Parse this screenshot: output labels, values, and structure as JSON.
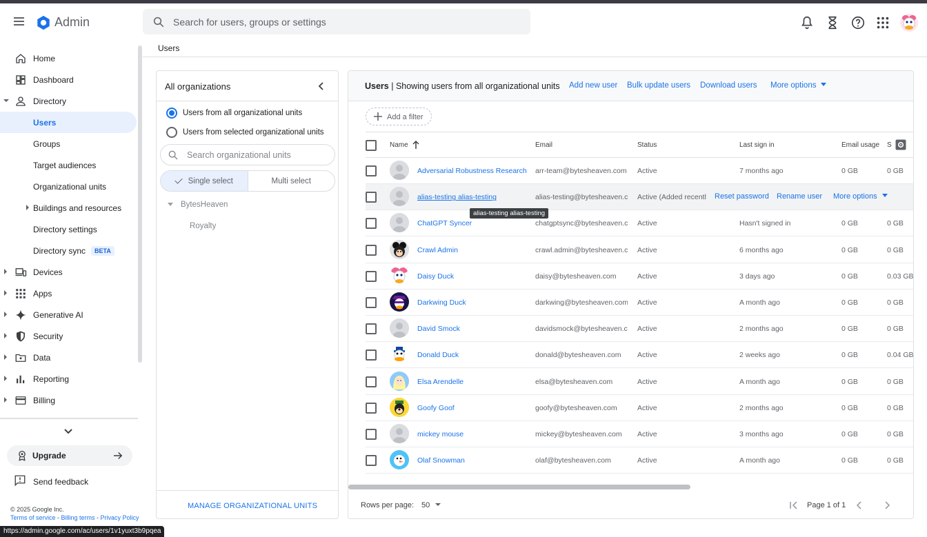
{
  "header": {
    "app_title": "Admin",
    "search_placeholder": "Search for users, groups or settings",
    "icons": [
      "notifications-icon",
      "tasks-icon",
      "help-icon",
      "apps-grid-icon",
      "account-avatar"
    ]
  },
  "breadcrumb": "Users",
  "sidebar": {
    "items": [
      {
        "label": "Home",
        "icon": "home-icon"
      },
      {
        "label": "Dashboard",
        "icon": "dashboard-icon"
      },
      {
        "label": "Directory",
        "icon": "person-icon",
        "expanded": true
      },
      {
        "label": "Users",
        "active": true
      },
      {
        "label": "Groups"
      },
      {
        "label": "Target audiences"
      },
      {
        "label": "Organizational units"
      },
      {
        "label": "Buildings and resources"
      },
      {
        "label": "Directory settings"
      },
      {
        "label": "Directory sync",
        "badge": "BETA"
      },
      {
        "label": "Devices",
        "icon": "devices-icon"
      },
      {
        "label": "Apps",
        "icon": "apps-icon"
      },
      {
        "label": "Generative AI",
        "icon": "sparkle-icon"
      },
      {
        "label": "Security",
        "icon": "shield-icon"
      },
      {
        "label": "Data",
        "icon": "folder-icon"
      },
      {
        "label": "Reporting",
        "icon": "bar-chart-icon"
      },
      {
        "label": "Billing",
        "icon": "credit-card-icon"
      }
    ],
    "upgrade": "Upgrade",
    "send_feedback": "Send feedback",
    "copyright": "© 2025 Google Inc.",
    "terms": "Terms of service",
    "billing_terms": "Billing terms",
    "privacy": "Privacy Policy",
    "legal_sep": " - "
  },
  "status_url": "https://admin.google.com/ac/users/1v1yuxt3b9pqea",
  "org_panel": {
    "title": "All organizations",
    "radio_all": "Users from all organizational units",
    "radio_selected": "Users from selected organizational units",
    "search_placeholder": "Search organizational units",
    "single_select": "Single select",
    "multi_select": "Multi select",
    "tree": [
      "BytesHeaven",
      "Royalty"
    ],
    "manage": "MANAGE ORGANIZATIONAL UNITS"
  },
  "users_panel": {
    "title_bold": "Users",
    "title_rest": " | Showing users from all organizational units",
    "actions": [
      "Add new user",
      "Bulk update users",
      "Download users",
      "More options"
    ],
    "add_filter": "Add a filter",
    "columns": [
      "Name",
      "Email",
      "Status",
      "Last sign in",
      "Email usage",
      "S"
    ],
    "rows": [
      {
        "name": "Adversarial Robustness Research",
        "email": "arr-team@bytesheaven.com",
        "status": "Active",
        "last": "7 months ago",
        "usage": "0 GB",
        "storage": "0 GB",
        "avatar": "default"
      },
      {
        "name": "alias-testing alias-testing",
        "email": "alias-testing@bytesheaven.com",
        "status": "Active (Added recently)",
        "last": "",
        "usage": "",
        "storage": "",
        "avatar": "default",
        "hover": true
      },
      {
        "name": "ChatGPT Syncer",
        "email": "chatgptsync@bytesheaven.com",
        "status": "Active",
        "last": "Hasn't signed in",
        "usage": "0 GB",
        "storage": "0 GB",
        "avatar": "default"
      },
      {
        "name": "Crawl Admin",
        "email": "crawl.admin@bytesheaven.com",
        "status": "Active",
        "last": "6 months ago",
        "usage": "0 GB",
        "storage": "0 GB",
        "avatar": "crawl"
      },
      {
        "name": "Daisy Duck",
        "email": "daisy@bytesheaven.com",
        "status": "Active",
        "last": "3 days ago",
        "usage": "0 GB",
        "storage": "0.03 GB",
        "avatar": "daisy"
      },
      {
        "name": "Darkwing Duck",
        "email": "darkwing@bytesheaven.com",
        "status": "Active",
        "last": "A month ago",
        "usage": "0 GB",
        "storage": "0 GB",
        "avatar": "darkwing"
      },
      {
        "name": "David Smock",
        "email": "davidsmock@bytesheaven.com",
        "status": "Active",
        "last": "2 months ago",
        "usage": "0 GB",
        "storage": "0 GB",
        "avatar": "default"
      },
      {
        "name": "Donald Duck",
        "email": "donald@bytesheaven.com",
        "status": "Active",
        "last": "2 weeks ago",
        "usage": "0 GB",
        "storage": "0.04 GB",
        "avatar": "donald"
      },
      {
        "name": "Elsa Arendelle",
        "email": "elsa@bytesheaven.com",
        "status": "Active",
        "last": "A month ago",
        "usage": "0 GB",
        "storage": "0 GB",
        "avatar": "elsa"
      },
      {
        "name": "Goofy Goof",
        "email": "goofy@bytesheaven.com",
        "status": "Active",
        "last": "2 months ago",
        "usage": "0 GB",
        "storage": "0 GB",
        "avatar": "goofy"
      },
      {
        "name": "mickey mouse",
        "email": "mickey@bytesheaven.com",
        "status": "Active",
        "last": "3 months ago",
        "usage": "0 GB",
        "storage": "0 GB",
        "avatar": "default"
      },
      {
        "name": "Olaf Snowman",
        "email": "olaf@bytesheaven.com",
        "status": "Active",
        "last": "A month ago",
        "usage": "0 GB",
        "storage": "0 GB",
        "avatar": "olaf"
      }
    ],
    "row_actions": [
      "Reset password",
      "Rename user",
      "More options"
    ],
    "tooltip": "alias-testing alias-testing",
    "rows_per_page_label": "Rows per page:",
    "rows_per_page": "50",
    "page_info": "Page 1 of 1"
  },
  "colors": {
    "accent": "#1a73e8",
    "active_bg": "#e8f0fe",
    "text": "#202124"
  }
}
